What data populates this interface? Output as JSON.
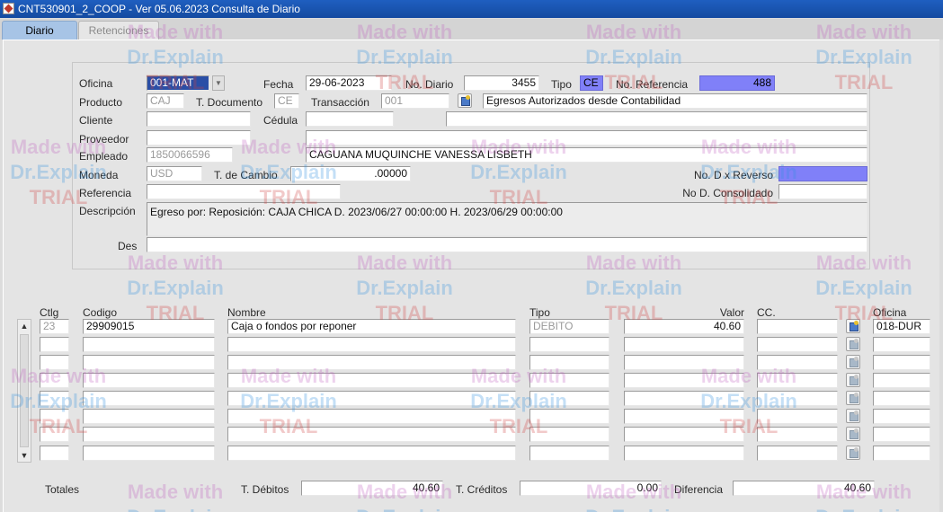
{
  "window": {
    "title": "CNT530901_2_COOP - Ver 05.06.2023 Consulta de Diario"
  },
  "tabs": [
    {
      "label": "Diario"
    },
    {
      "label": "Retenciones"
    }
  ],
  "header": {
    "oficina": {
      "label": "Oficina",
      "value": "001-MAT"
    },
    "fecha": {
      "label": "Fecha",
      "value": "29-06-2023"
    },
    "no_diario": {
      "label": "No. Diario",
      "value": "3455"
    },
    "tipo": {
      "label": "Tipo",
      "value": "CE"
    },
    "no_referencia": {
      "label": "No. Referencia",
      "value": "488"
    },
    "producto": {
      "label": "Producto",
      "value": "CAJ"
    },
    "t_documento": {
      "label": "T. Documento",
      "value": "CE"
    },
    "transaccion": {
      "label": "Transacción",
      "value": "001",
      "description": "Egresos Autorizados desde Contabilidad"
    },
    "cliente": {
      "label": "Cliente",
      "value": ""
    },
    "cedula": {
      "label": "Cédula",
      "value": ""
    },
    "proveedor": {
      "label": "Proveedor",
      "value": ""
    },
    "empleado": {
      "label": "Empleado",
      "value": "1850066596",
      "name": "CAGUANA MUQUINCHE VANESSA LISBETH"
    },
    "moneda": {
      "label": "Moneda",
      "value": "USD"
    },
    "t_cambio": {
      "label": "T. de Cambio",
      "value": ".00000"
    },
    "no_reverso": {
      "label": "No. D x Reverso",
      "value": ""
    },
    "referencia": {
      "label": "Referencia",
      "value": ""
    },
    "no_consolidado": {
      "label": "No D. Consolidado",
      "value": ""
    },
    "descripcion": {
      "label": "Descripción",
      "value": "Egreso por:  Reposición: CAJA CHICA D. 2023/06/27 00:00:00 H. 2023/06/29 00:00:00"
    },
    "des": {
      "label": "Des",
      "value": ""
    }
  },
  "detail": {
    "columns": {
      "ctlg": "Ctlg",
      "codigo": "Codigo",
      "nombre": "Nombre",
      "tipo": "Tipo",
      "valor": "Valor",
      "cc": "CC.",
      "oficina": "Oficina"
    },
    "rows": [
      {
        "ctlg": "23",
        "codigo": "29909015",
        "nombre": "Caja o fondos por reponer",
        "tipo": "DEBITO",
        "valor": "40.60",
        "cc": "",
        "oficina": "018-DUR"
      },
      {
        "ctlg": "",
        "codigo": "",
        "nombre": "",
        "tipo": "",
        "valor": "",
        "cc": "",
        "oficina": ""
      },
      {
        "ctlg": "",
        "codigo": "",
        "nombre": "",
        "tipo": "",
        "valor": "",
        "cc": "",
        "oficina": ""
      },
      {
        "ctlg": "",
        "codigo": "",
        "nombre": "",
        "tipo": "",
        "valor": "",
        "cc": "",
        "oficina": ""
      },
      {
        "ctlg": "",
        "codigo": "",
        "nombre": "",
        "tipo": "",
        "valor": "",
        "cc": "",
        "oficina": ""
      },
      {
        "ctlg": "",
        "codigo": "",
        "nombre": "",
        "tipo": "",
        "valor": "",
        "cc": "",
        "oficina": ""
      },
      {
        "ctlg": "",
        "codigo": "",
        "nombre": "",
        "tipo": "",
        "valor": "",
        "cc": "",
        "oficina": ""
      },
      {
        "ctlg": "",
        "codigo": "",
        "nombre": "",
        "tipo": "",
        "valor": "",
        "cc": "",
        "oficina": ""
      }
    ]
  },
  "totals": {
    "label": "Totales",
    "debitos": {
      "label": "T. Débitos",
      "value": "40.60"
    },
    "creditos": {
      "label": "T. Créditos",
      "value": "0.00"
    },
    "diferencia": {
      "label": "Diferencia",
      "value": "40.60"
    }
  },
  "watermark": {
    "line1": "Made with",
    "line2": "Dr.Explain",
    "line3": "TRIAL"
  },
  "icons": {
    "app": "app-icon",
    "dropdown": "chevron-down-icon",
    "lov": "list-of-values-icon",
    "scroll_up": "arrow-up-icon",
    "scroll_down": "arrow-down-icon"
  }
}
